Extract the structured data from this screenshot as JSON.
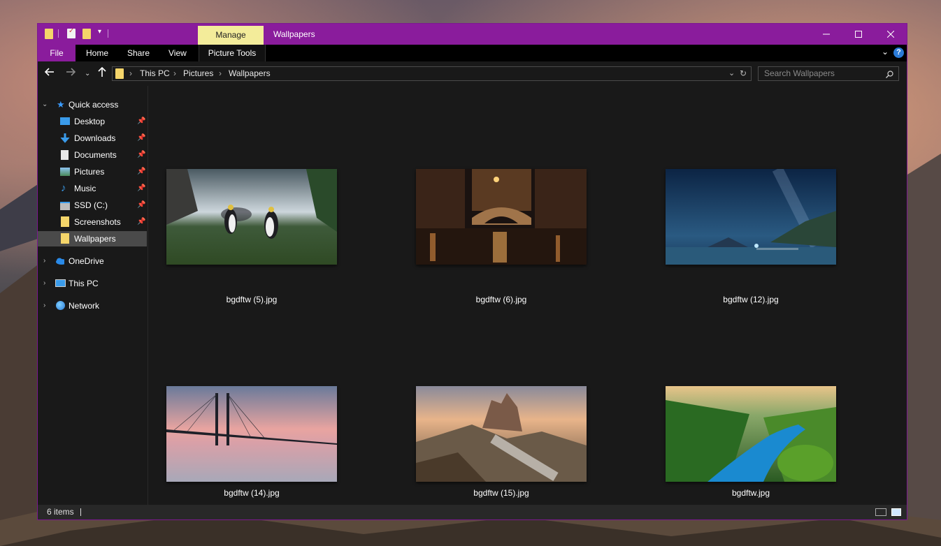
{
  "window": {
    "title": "Wallpapers",
    "context_tab": "Manage",
    "accent": "#8a1c9c"
  },
  "ribbon": {
    "tabs": [
      "File",
      "Home",
      "Share",
      "View",
      "Picture Tools"
    ]
  },
  "address": {
    "crumbs": [
      "This PC",
      "Pictures",
      "Wallpapers"
    ]
  },
  "search": {
    "placeholder": "Search Wallpapers"
  },
  "sidebar": {
    "quick_access": "Quick access",
    "items": [
      {
        "label": "Desktop",
        "icon": "desktop-icon",
        "pinned": true
      },
      {
        "label": "Downloads",
        "icon": "download-icon",
        "pinned": true
      },
      {
        "label": "Documents",
        "icon": "document-icon",
        "pinned": true
      },
      {
        "label": "Pictures",
        "icon": "pictures-icon",
        "pinned": true
      },
      {
        "label": "Music",
        "icon": "music-icon",
        "pinned": true
      },
      {
        "label": "SSD (C:)",
        "icon": "drive-icon",
        "pinned": true
      },
      {
        "label": "Screenshots",
        "icon": "folder-icon",
        "pinned": true
      },
      {
        "label": "Wallpapers",
        "icon": "folder-icon",
        "pinned": false
      }
    ],
    "onedrive": "OneDrive",
    "thispc": "This PC",
    "network": "Network"
  },
  "files": [
    {
      "name": "bgdftw (5).jpg"
    },
    {
      "name": "bgdftw (6).jpg"
    },
    {
      "name": "bgdftw (12).jpg"
    },
    {
      "name": "bgdftw (14).jpg"
    },
    {
      "name": "bgdftw (15).jpg"
    },
    {
      "name": "bgdftw.jpg"
    }
  ],
  "status": {
    "count": "6 items"
  }
}
